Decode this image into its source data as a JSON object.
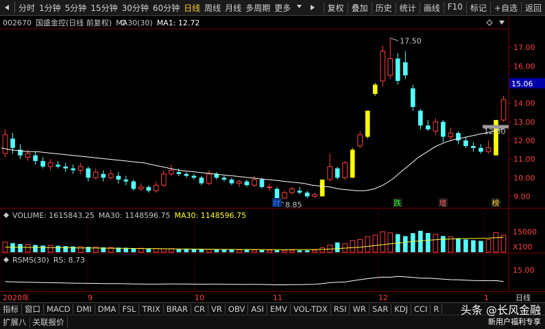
{
  "toolbar": {
    "periods": [
      "分时",
      "1分钟",
      "5分钟",
      "15分钟",
      "30分钟",
      "60分钟",
      "日线",
      "周线",
      "月线",
      "多周期",
      "更多"
    ],
    "active_period": "日线",
    "right_buttons": [
      "复权",
      "叠加",
      "历史",
      "统计",
      "画线",
      "F10",
      "标记",
      "+自选",
      "返回"
    ]
  },
  "header": {
    "code": "002670",
    "name": "国盛金控(日线 前复权)",
    "ma_label": "MA30(30)",
    "ma_value": "MA1: 12.72"
  },
  "volume_header": {
    "volume": "VOLUME: 1615843.25",
    "ma30a": "MA30: 1148596.75",
    "ma30b": "MA30: 1148596.75"
  },
  "rsms_header": {
    "name": "RSMS(30)",
    "rs": "RS: 8.73"
  },
  "price_axis": [
    "17.00",
    "16.00",
    "15.00",
    "14.00",
    "13.00",
    "12.00",
    "11.00",
    "10.00",
    "9.00"
  ],
  "current_price": "15.06",
  "volume_axis": {
    "label": "15000",
    "unit": "X100"
  },
  "rsms_axis": "15.00",
  "annotations": {
    "high": "17.50",
    "low": "8.85",
    "ma_tag": "12.50"
  },
  "markers": [
    "财",
    "跌",
    "增",
    "榜"
  ],
  "x_axis": {
    "labels": [
      "2020年",
      "9",
      "10",
      "11",
      "12",
      "1"
    ],
    "right_label": "日线"
  },
  "indicator_tabs": [
    "指标",
    "窗口",
    "MACD",
    "DMI",
    "DMA",
    "FSL",
    "TRIX",
    "BRAR",
    "CR",
    "VR",
    "OBV",
    "ASI",
    "EMV",
    "VOL-TDX",
    "RSI",
    "WR",
    "SAR",
    "KDJ",
    "CCI",
    "R"
  ],
  "bottom_tabs": [
    "扩展八",
    "关联报价"
  ],
  "watermark": {
    "main": "头条 @长风金融",
    "sub": "新用户福利专享"
  },
  "colors": {
    "up": "#ff4040",
    "down": "#54ffff",
    "ma": "#ffffff",
    "highlight": "#ffff00",
    "grid": "#7a0000",
    "ma_yellow": "#ffff33"
  },
  "chart_data": {
    "type": "candlestick",
    "price_range": [
      8.5,
      18.0
    ],
    "ma30_line": [
      11.6,
      11.5,
      11.45,
      11.4,
      11.4,
      11.35,
      11.3,
      11.25,
      11.2,
      11.15,
      11.1,
      11.05,
      11.0,
      10.95,
      10.9,
      10.85,
      10.8,
      10.7,
      10.6,
      10.5,
      10.4,
      10.35,
      10.3,
      10.25,
      10.2,
      10.15,
      10.1,
      10.05,
      10.0,
      9.95,
      9.9,
      9.85,
      9.8,
      9.75,
      9.7,
      9.6,
      9.55,
      9.5,
      9.4,
      9.35,
      9.3,
      9.3,
      9.4,
      9.6,
      9.9,
      10.3,
      10.7,
      11.1,
      11.4,
      11.7,
      11.9,
      12.05,
      12.15,
      12.25,
      12.35,
      12.45,
      12.55,
      12.72
    ],
    "candles": [
      {
        "o": 11.3,
        "c": 12.3,
        "h": 12.6,
        "l": 11.1
      },
      {
        "o": 12.1,
        "c": 11.6,
        "h": 12.4,
        "l": 11.3
      },
      {
        "o": 11.5,
        "c": 11.2,
        "h": 11.8,
        "l": 11.0
      },
      {
        "o": 11.1,
        "c": 11.3,
        "h": 11.5,
        "l": 10.9
      },
      {
        "o": 11.2,
        "c": 10.9,
        "h": 11.4,
        "l": 10.7
      },
      {
        "o": 10.9,
        "c": 10.6,
        "h": 11.1,
        "l": 10.5
      },
      {
        "o": 10.6,
        "c": 10.8,
        "h": 11.0,
        "l": 10.4
      },
      {
        "o": 10.7,
        "c": 10.6,
        "h": 10.9,
        "l": 10.5
      },
      {
        "o": 10.6,
        "c": 10.5,
        "h": 10.8,
        "l": 10.3
      },
      {
        "o": 10.5,
        "c": 10.4,
        "h": 10.7,
        "l": 10.2
      },
      {
        "o": 10.4,
        "c": 10.6,
        "h": 10.8,
        "l": 10.2
      },
      {
        "o": 10.5,
        "c": 10.0,
        "h": 10.6,
        "l": 9.8
      },
      {
        "o": 10.0,
        "c": 10.3,
        "h": 10.5,
        "l": 9.9
      },
      {
        "o": 10.2,
        "c": 10.0,
        "h": 10.4,
        "l": 9.8
      },
      {
        "o": 10.0,
        "c": 10.2,
        "h": 10.4,
        "l": 9.9
      },
      {
        "o": 10.1,
        "c": 9.9,
        "h": 10.3,
        "l": 9.7
      },
      {
        "o": 9.9,
        "c": 9.8,
        "h": 10.1,
        "l": 9.6
      },
      {
        "o": 9.8,
        "c": 9.4,
        "h": 9.9,
        "l": 9.3
      },
      {
        "o": 9.4,
        "c": 9.5,
        "h": 9.7,
        "l": 9.3
      },
      {
        "o": 9.5,
        "c": 9.3,
        "h": 9.6,
        "l": 9.2
      },
      {
        "o": 9.3,
        "c": 9.6,
        "h": 9.8,
        "l": 9.2
      },
      {
        "o": 9.6,
        "c": 10.2,
        "h": 10.4,
        "l": 9.5
      },
      {
        "o": 10.2,
        "c": 10.4,
        "h": 10.7,
        "l": 10.1
      },
      {
        "o": 10.3,
        "c": 10.2,
        "h": 10.5,
        "l": 10.1
      },
      {
        "o": 10.2,
        "c": 10.1,
        "h": 10.3,
        "l": 10.0
      },
      {
        "o": 10.1,
        "c": 10.0,
        "h": 10.2,
        "l": 9.9
      },
      {
        "o": 10.0,
        "c": 9.7,
        "h": 10.1,
        "l": 9.6
      },
      {
        "o": 9.7,
        "c": 10.2,
        "h": 10.4,
        "l": 9.6
      },
      {
        "o": 10.2,
        "c": 10.0,
        "h": 10.3,
        "l": 9.9
      },
      {
        "o": 10.0,
        "c": 9.9,
        "h": 10.1,
        "l": 9.8
      },
      {
        "o": 9.9,
        "c": 9.7,
        "h": 10.0,
        "l": 9.6
      },
      {
        "o": 9.7,
        "c": 9.8,
        "h": 9.9,
        "l": 9.5
      },
      {
        "o": 9.8,
        "c": 9.6,
        "h": 9.9,
        "l": 9.5
      },
      {
        "o": 9.6,
        "c": 9.9,
        "h": 10.1,
        "l": 9.5
      },
      {
        "o": 9.9,
        "c": 9.5,
        "h": 10.0,
        "l": 9.4
      },
      {
        "o": 9.5,
        "c": 9.5,
        "h": 9.7,
        "l": 9.3
      },
      {
        "o": 9.4,
        "c": 8.85,
        "h": 9.5,
        "l": 8.85
      },
      {
        "o": 8.9,
        "c": 9.2,
        "h": 9.3,
        "l": 8.85
      },
      {
        "o": 9.2,
        "c": 9.4,
        "h": 9.5,
        "l": 9.1
      },
      {
        "o": 9.3,
        "c": 9.2,
        "h": 9.5,
        "l": 9.1
      },
      {
        "o": 9.2,
        "c": 9.0,
        "h": 9.3,
        "l": 8.9
      },
      {
        "o": 9.0,
        "c": 9.1,
        "h": 9.2,
        "l": 8.9
      },
      {
        "o": 9.0,
        "c": 9.9,
        "h": 9.9,
        "l": 9.0,
        "hl": true
      },
      {
        "o": 9.9,
        "c": 10.6,
        "h": 11.3,
        "l": 9.8
      },
      {
        "o": 10.5,
        "c": 10.0,
        "h": 10.6,
        "l": 9.9
      },
      {
        "o": 10.0,
        "c": 10.8,
        "h": 10.9,
        "l": 9.9
      },
      {
        "o": 10.0,
        "c": 11.5,
        "h": 11.6,
        "l": 10.0,
        "hl": true
      },
      {
        "o": 11.7,
        "c": 12.3,
        "h": 12.5,
        "l": 11.6
      },
      {
        "o": 12.2,
        "c": 13.6,
        "h": 13.6,
        "l": 12.1,
        "hl": true
      },
      {
        "o": 14.5,
        "c": 15.0,
        "h": 15.1,
        "l": 14.4,
        "hl": true
      },
      {
        "o": 15.2,
        "c": 16.8,
        "h": 17.1,
        "l": 14.9
      },
      {
        "o": 15.5,
        "c": 16.4,
        "h": 17.5,
        "l": 15.3
      },
      {
        "o": 16.4,
        "c": 15.2,
        "h": 16.7,
        "l": 15.0
      },
      {
        "o": 16.2,
        "c": 15.5,
        "h": 16.8,
        "l": 15.3
      },
      {
        "o": 14.8,
        "c": 13.8,
        "h": 15.0,
        "l": 13.6
      },
      {
        "o": 13.6,
        "c": 12.8,
        "h": 13.7,
        "l": 12.6
      },
      {
        "o": 12.8,
        "c": 12.6,
        "h": 13.1,
        "l": 12.5
      },
      {
        "o": 12.5,
        "c": 13.0,
        "h": 13.2,
        "l": 12.3
      },
      {
        "o": 13.0,
        "c": 12.2,
        "h": 13.1,
        "l": 11.9
      },
      {
        "o": 12.2,
        "c": 12.4,
        "h": 12.7,
        "l": 12.0
      },
      {
        "o": 12.4,
        "c": 12.0,
        "h": 12.5,
        "l": 11.8
      },
      {
        "o": 12.0,
        "c": 11.7,
        "h": 12.2,
        "l": 11.6
      },
      {
        "o": 11.7,
        "c": 11.6,
        "h": 11.9,
        "l": 11.4
      },
      {
        "o": 11.6,
        "c": 11.4,
        "h": 11.8,
        "l": 11.3
      },
      {
        "o": 11.4,
        "c": 11.6,
        "h": 12.0,
        "l": 11.3
      },
      {
        "o": 11.2,
        "c": 13.1,
        "h": 13.1,
        "l": 11.2,
        "hl": true
      },
      {
        "o": 13.1,
        "c": 14.2,
        "h": 14.4,
        "l": 13.0
      }
    ],
    "volume_range": [
      0,
      20000
    ],
    "volumes": [
      6500,
      5800,
      5200,
      5000,
      4600,
      4200,
      4400,
      4100,
      3900,
      3700,
      3600,
      3400,
      3300,
      3100,
      3000,
      2900,
      2800,
      2600,
      2500,
      2400,
      2300,
      2200,
      2300,
      2100,
      2000,
      1900,
      1800,
      1800,
      1700,
      1600,
      1600,
      1500,
      1500,
      1400,
      1400,
      1300,
      1300,
      1200,
      1300,
      1200,
      1200,
      1300,
      2800,
      4500,
      6200,
      5400,
      7400,
      8100,
      9900,
      10800,
      13000,
      12300,
      11500,
      10200,
      12100,
      13600,
      12200,
      11400,
      10300,
      9800,
      8900,
      8100,
      7600,
      7200,
      8000,
      12500,
      10800
    ],
    "volume_ma": [
      3200,
      3200,
      3150,
      3100,
      3050,
      3000,
      2950,
      2900,
      2850,
      2800,
      2750,
      2700,
      2650,
      2600,
      2550,
      2500,
      2450,
      2400,
      2350,
      2300,
      2250,
      2200,
      2150,
      2100,
      2050,
      2000,
      1950,
      1900,
      1850,
      1800,
      1780,
      1760,
      1740,
      1720,
      1700,
      1690,
      1680,
      1670,
      1680,
      1690,
      1700,
      1720,
      1800,
      2000,
      2300,
      2600,
      2900,
      3200,
      3700,
      4200,
      4800,
      5300,
      5800,
      6300,
      6800,
      7200,
      7600,
      7900,
      8200,
      8400,
      8600,
      8700,
      8750,
      8800,
      8900,
      9200,
      9500
    ],
    "rsms_range": [
      0,
      25
    ],
    "rsms": [
      8.6,
      8.4,
      8.2,
      8.0,
      7.9,
      7.7,
      7.6,
      7.5,
      7.3,
      7.2,
      7.1,
      7.0,
      6.9,
      6.8,
      6.8,
      6.7,
      6.6,
      6.4,
      6.3,
      6.2,
      6.2,
      6.3,
      6.4,
      6.3,
      6.3,
      6.2,
      6.1,
      6.2,
      6.2,
      6.1,
      6.0,
      6.0,
      5.9,
      6.0,
      5.9,
      5.8,
      5.6,
      5.6,
      5.7,
      5.8,
      5.9,
      6.1,
      6.8,
      7.6,
      8.0,
      8.3,
      9.5,
      10.5,
      11.5,
      12.4,
      13.0,
      12.8,
      13.6,
      13.2,
      12.6,
      11.9,
      12.0,
      11.5,
      11.0,
      10.5,
      10.3,
      10.0,
      9.7,
      9.6,
      9.5,
      9.6,
      8.73
    ]
  }
}
